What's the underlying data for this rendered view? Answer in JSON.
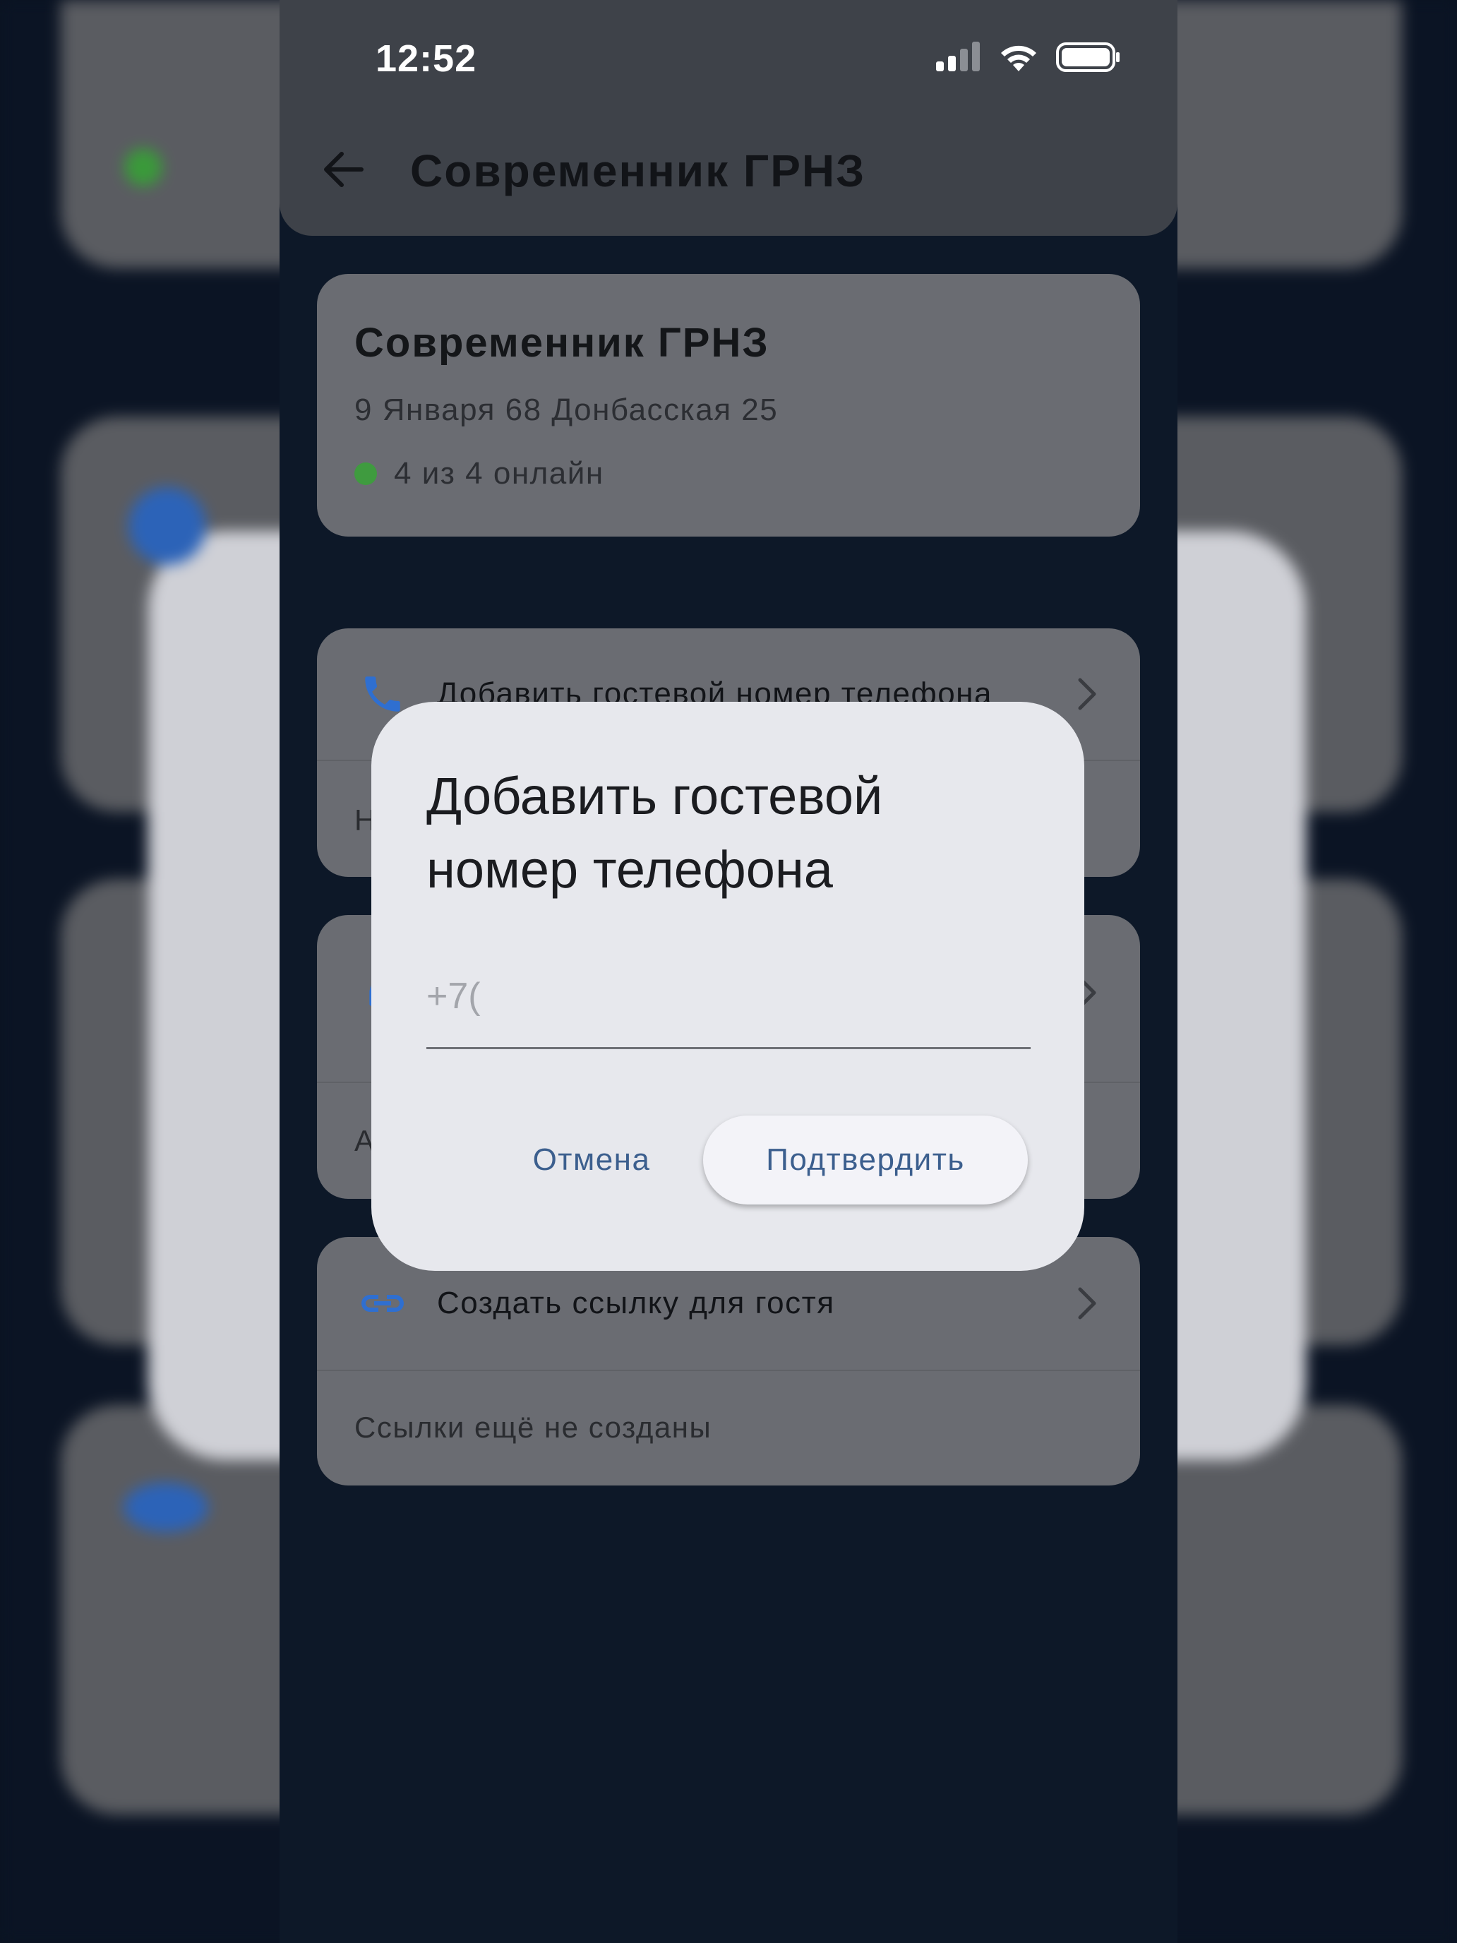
{
  "status_bar": {
    "time": "12:52",
    "icons": [
      "cellular-signal-icon",
      "wifi-icon",
      "battery-icon"
    ]
  },
  "app_bar": {
    "title": "Современник ГРНЗ",
    "back_icon": "arrow-left-icon"
  },
  "info_card": {
    "title": "Современник ГРНЗ",
    "address": "9 Января 68 Донбасская 25",
    "status_text": "4 из 4 онлайн",
    "status_color": "#3f9b3f"
  },
  "phone_card": {
    "label": "Добавить гостевой номер телефона",
    "icon": "phone-icon",
    "note": "Н"
  },
  "car_card": {
    "icon": "car-icon",
    "note": "А"
  },
  "link_card": {
    "label": "Создать ссылку для гостя",
    "icon": "link-icon",
    "note": "Ссылки ещё не созданы"
  },
  "dialog": {
    "title": "Добавить гостевой номер телефона",
    "input_placeholder": "+7(",
    "input_value": "",
    "cancel_label": "Отмена",
    "confirm_label": "Подтвердить"
  },
  "colors": {
    "accent": "#3c5f8e",
    "icon_blue": "#2f6fd0",
    "dialog_bg": "#e7e8ed",
    "online_green": "#3f9b3f"
  }
}
